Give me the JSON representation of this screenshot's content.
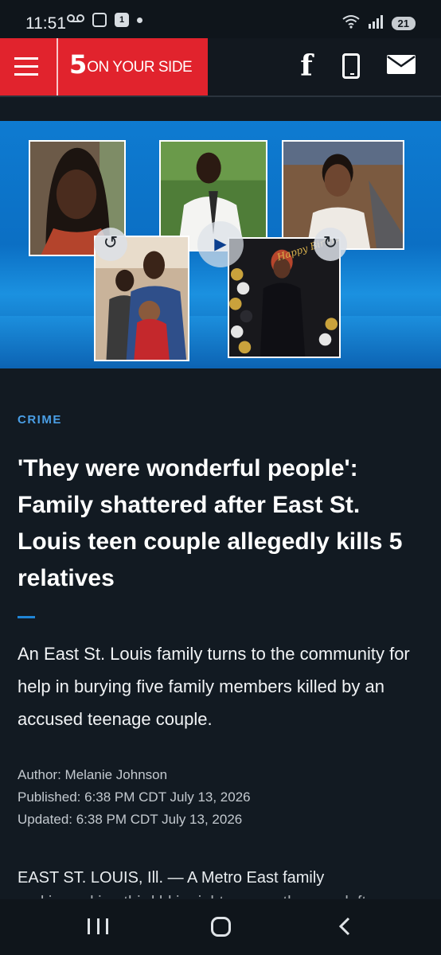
{
  "status_bar": {
    "time": "11:51",
    "notification_badge": "1",
    "battery": "21",
    "icons": [
      "voicemail-icon",
      "screenshot-icon",
      "calendar-icon",
      "dot-icon",
      "wifi-icon",
      "signal-icon",
      "battery-icon"
    ]
  },
  "header": {
    "logo_number": "5",
    "logo_text": "ON YOUR SIDE",
    "brand_color": "#e1232d",
    "facebook_glyph": "f",
    "icons": [
      "menu-icon",
      "facebook-icon",
      "phone-icon",
      "mail-icon"
    ]
  },
  "hero": {
    "background_color": "#0e7bd1",
    "photos": [
      "portrait-young-woman",
      "portrait-young-man",
      "portrait-woman-smiling",
      "portrait-family-with-baby",
      "portrait-woman-birthday"
    ],
    "birthday_sign": "Happy Birthday",
    "controls": [
      "replay-icon",
      "play-icon",
      "forward-icon"
    ]
  },
  "article": {
    "category": "CRIME",
    "headline": "'They were wonderful people': Family shattered after East St. Louis teen couple allegedly kills 5 relatives",
    "summary": "An East St. Louis family turns to the community for help in burying five family members killed by an accused teenage couple.",
    "author": "Author: Melanie Johnson",
    "published": "Published: 6:38 PM CDT July 13, 2026",
    "updated": "Updated: 6:38 PM CDT July 13, 2026",
    "body_first_line": "EAST ST. LOUIS, Ill. — A Metro East family",
    "body_second_line": "and is seeking third ld in right now as they are left",
    "accent_color": "#1f85d6"
  },
  "nav_bar": {
    "icons": [
      "recents-icon",
      "home-icon",
      "back-icon"
    ]
  }
}
